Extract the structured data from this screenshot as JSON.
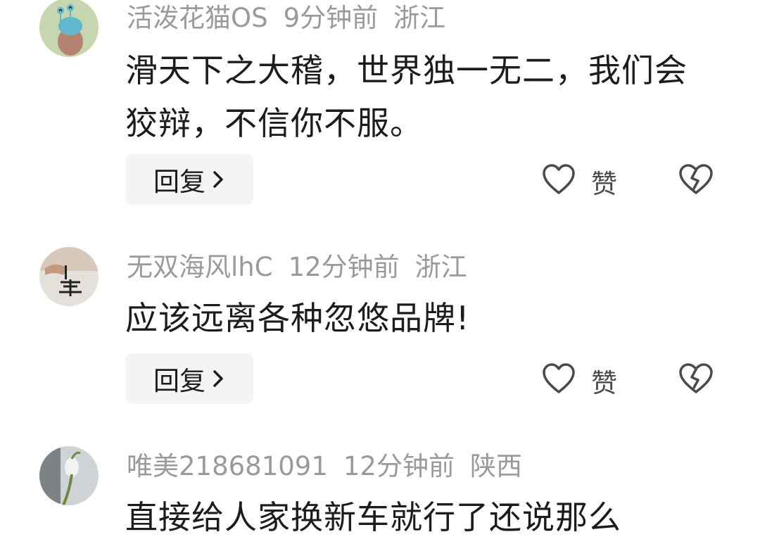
{
  "comments": [
    {
      "username": "活泼花猫OS",
      "time": "9分钟前",
      "location": "浙江",
      "content": "滑天下之大稽，世界独一无二，我们会狡辩，不信你不服。",
      "reply_label": "回复",
      "like_label": "赞"
    },
    {
      "username": "无双海风lhC",
      "time": "12分钟前",
      "location": "浙江",
      "content": "应该远离各种忽悠品牌!",
      "reply_label": "回复",
      "like_label": "赞"
    },
    {
      "username": "唯美218681091",
      "time": "12分钟前",
      "location": "陕西",
      "content": "直接给人家换新车就行了还说那么"
    }
  ],
  "icons": {
    "like": "heart-outline-icon",
    "dislike": "broken-heart-icon",
    "reply_arrow": "chevron-right-icon"
  },
  "colors": {
    "meta_text": "#9a9a9a",
    "body_text": "#1c1c1c",
    "reply_bg": "#f3f4f6",
    "icon_stroke": "#4a4a4a"
  }
}
